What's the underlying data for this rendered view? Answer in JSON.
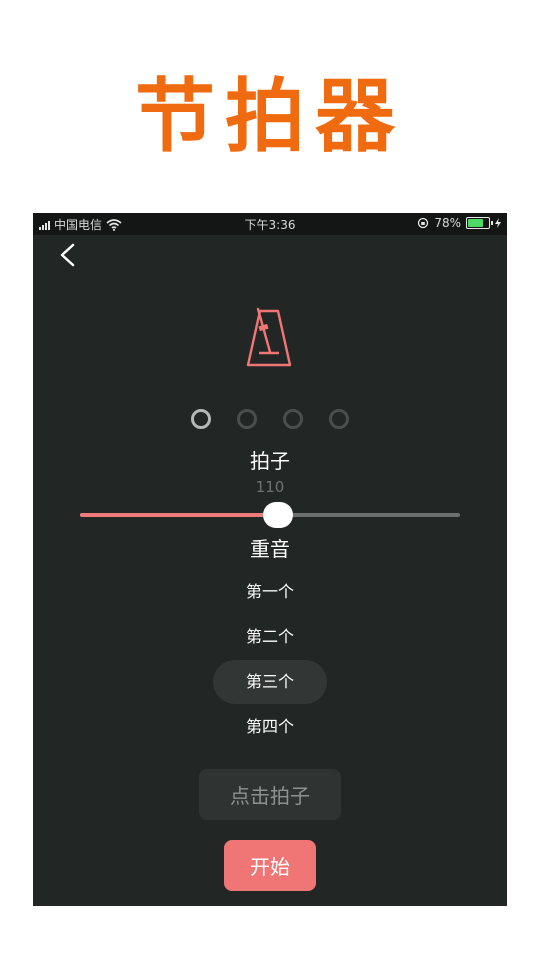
{
  "banner": {
    "title": "节拍器"
  },
  "status_bar": {
    "carrier": "中国电信",
    "time": "下午3:36",
    "battery_text": "78%",
    "battery_level": 0.78
  },
  "beat_dots": {
    "count": 4,
    "active_index": 0
  },
  "beat": {
    "title": "拍子",
    "bpm": "110"
  },
  "slider": {
    "value_fraction": 0.52
  },
  "accent": {
    "title": "重音",
    "options": [
      "第一个",
      "第二个",
      "第三个",
      "第四个"
    ],
    "selected_index": 2
  },
  "buttons": {
    "tap": "点击拍子",
    "start": "开始"
  },
  "colors": {
    "banner": "#f06a10",
    "background": "#222725",
    "accent": "#f07676",
    "battery": "#4cd964"
  },
  "icons": {
    "back": "chevron-left-icon",
    "metronome": "metronome-icon"
  }
}
